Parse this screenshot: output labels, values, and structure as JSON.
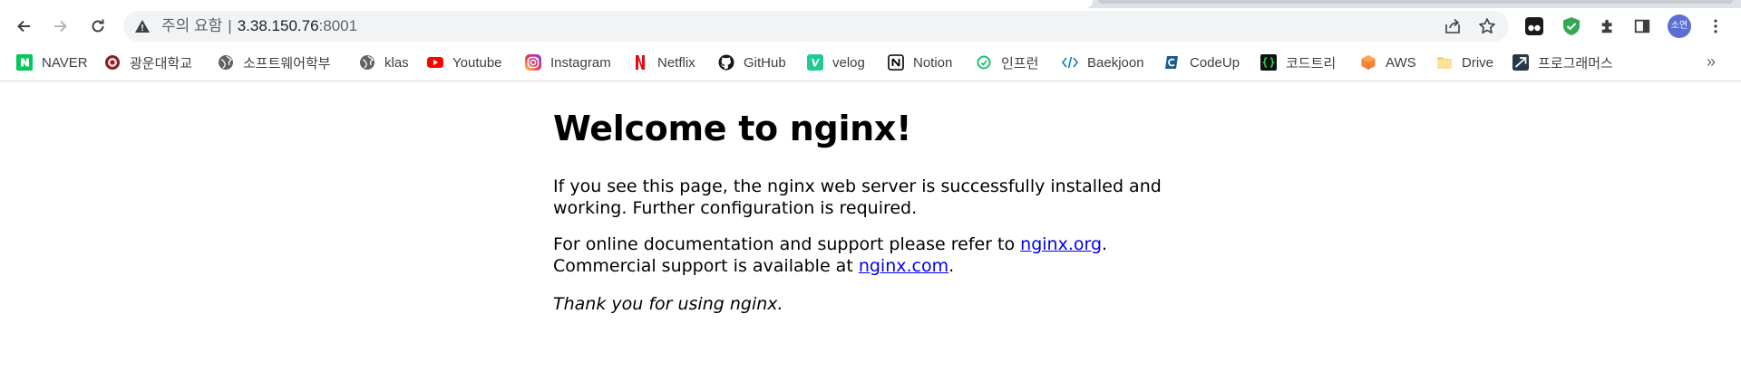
{
  "browser": {
    "address_bar": {
      "security_label": "주의 요함",
      "url_host": "3.38.150.76",
      "url_port": ":8001"
    },
    "profile_initials": "소연"
  },
  "bookmarks": [
    {
      "label": "NAVER",
      "icon": "naver-icon",
      "color": "#03c75a"
    },
    {
      "label": "광운대학교",
      "icon": "kwangwoon-icon",
      "color": "#8a1e2c"
    },
    {
      "label": "소프트웨어학부",
      "icon": "globe-icon",
      "color": "#5f6368"
    },
    {
      "label": "klas",
      "icon": "globe-icon",
      "color": "#5f6368"
    },
    {
      "label": "Youtube",
      "icon": "youtube-icon",
      "color": "#ff0000"
    },
    {
      "label": "Instagram",
      "icon": "instagram-icon",
      "color": "#d6249f"
    },
    {
      "label": "Netflix",
      "icon": "netflix-icon",
      "color": "#e50914"
    },
    {
      "label": "GitHub",
      "icon": "github-icon",
      "color": "#181717"
    },
    {
      "label": "velog",
      "icon": "velog-icon",
      "color": "#20c997"
    },
    {
      "label": "Notion",
      "icon": "notion-icon",
      "color": "#000000"
    },
    {
      "label": "인프런",
      "icon": "inflearn-icon",
      "color": "#1dc078"
    },
    {
      "label": "Baekjoon",
      "icon": "code-icon",
      "color": "#0076c0"
    },
    {
      "label": "CodeUp",
      "icon": "codeup-icon",
      "color": "#1b5a8a"
    },
    {
      "label": "코드트리",
      "icon": "codetree-icon",
      "color": "#2bd24b"
    },
    {
      "label": "AWS",
      "icon": "aws-icon",
      "color": "#f58536"
    },
    {
      "label": "Drive",
      "icon": "folder-icon",
      "color": "#f6d56b"
    },
    {
      "label": "프로그래머스",
      "icon": "programmers-icon",
      "color": "#263747"
    }
  ],
  "page": {
    "heading": "Welcome to nginx!",
    "para1_line1": "If you see this page, the nginx web server is successfully installed and",
    "para1_line2": "working. Further configuration is required.",
    "para2_line1_prefix": "For online documentation and support please refer to ",
    "para2_link1": "nginx.org",
    "para2_line1_suffix": ".",
    "para2_line2_prefix": "Commercial support is available at ",
    "para2_link2": "nginx.com",
    "para2_line2_suffix": ".",
    "para3": "Thank you for using nginx."
  }
}
